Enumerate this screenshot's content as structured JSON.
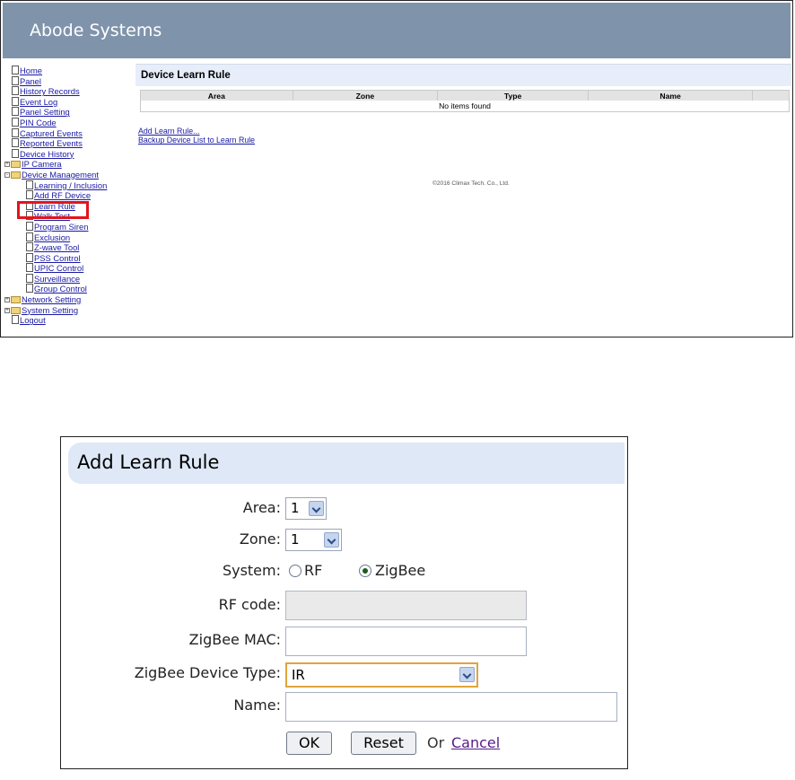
{
  "app": {
    "title": "Abode Systems"
  },
  "nav": {
    "items": [
      {
        "label": "Home"
      },
      {
        "label": "Panel"
      },
      {
        "label": "History Records"
      },
      {
        "label": "Event Log"
      },
      {
        "label": "Panel Setting"
      },
      {
        "label": "PIN Code"
      },
      {
        "label": "Captured Events"
      },
      {
        "label": "Reported Events"
      },
      {
        "label": "Device History"
      },
      {
        "label": "IP Camera"
      },
      {
        "label": "Device Management"
      },
      {
        "label": "Learning / Inclusion"
      },
      {
        "label": "Add RF Device"
      },
      {
        "label": "Learn Rule"
      },
      {
        "label": "Walk Test"
      },
      {
        "label": "Program Siren"
      },
      {
        "label": "Exclusion"
      },
      {
        "label": "Z-wave Tool"
      },
      {
        "label": "PSS Control"
      },
      {
        "label": "UPIC Control"
      },
      {
        "label": "Surveillance"
      },
      {
        "label": "Group Control"
      },
      {
        "label": "Network Setting"
      },
      {
        "label": "System Setting"
      },
      {
        "label": "Logout"
      }
    ],
    "expand_collapsed": "+",
    "expand_open": "-"
  },
  "device_learn_rule": {
    "title": "Device Learn Rule",
    "columns": [
      "Area",
      "Zone",
      "Type",
      "Name"
    ],
    "empty_text": "No items found",
    "links": {
      "add": "Add Learn Rule...",
      "backup": "Backup Device List to Learn Rule"
    },
    "copyright": "©2016 Climax Tech. Co., Ltd."
  },
  "add_learn_rule": {
    "title": "Add Learn Rule",
    "area": {
      "label": "Area:",
      "value": "1"
    },
    "zone": {
      "label": "Zone:",
      "value": "1"
    },
    "system": {
      "label": "System:",
      "options": [
        "RF",
        "ZigBee"
      ],
      "selected": "ZigBee"
    },
    "rf_code": {
      "label": "RF code:",
      "value": ""
    },
    "zigbee_mac": {
      "label": "ZigBee MAC:",
      "value": ""
    },
    "zigbee_type": {
      "label": "ZigBee Device Type:",
      "value": "IR"
    },
    "name": {
      "label": "Name:",
      "value": ""
    },
    "buttons": {
      "ok": "OK",
      "reset": "Reset",
      "or": "Or",
      "cancel": "Cancel"
    }
  },
  "colors": {
    "header_bg": "#7f93ab",
    "panel_header_bg": "#e7eefa",
    "highlight": "#e3141c",
    "link": "#1a1aa6",
    "visited_link": "#551a8b"
  }
}
